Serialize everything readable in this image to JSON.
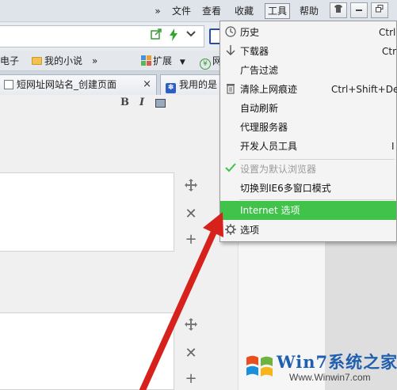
{
  "titlebar": {
    "menus": [
      {
        "label": "»"
      },
      {
        "label": "文件"
      },
      {
        "label": "查看"
      },
      {
        "label": "收藏"
      },
      {
        "label": "工具",
        "active": true
      },
      {
        "label": "帮助"
      }
    ],
    "window_buttons": [
      "shirt-icon",
      "minimize-icon",
      "restore-icon"
    ]
  },
  "bookmarks": {
    "items": [
      {
        "label": "电子",
        "icon": "folder-icon"
      },
      {
        "label": "我的小说",
        "icon": "folder-icon"
      },
      {
        "label": "»"
      },
      {
        "label": "扩展",
        "icon": "extensions-icon"
      },
      {
        "label": "网",
        "icon": "yen-icon"
      }
    ]
  },
  "tabs": [
    {
      "label": "短网址网站名_创建页面",
      "close": "×"
    },
    {
      "label": "我用的是"
    }
  ],
  "editor": {
    "format_buttons": [
      "B",
      "I"
    ]
  },
  "tools_menu": {
    "items": [
      {
        "label": "历史",
        "shortcut": "Ctrl",
        "icon": "clock-icon"
      },
      {
        "label": "下载器",
        "shortcut": "Ctr",
        "icon": "download-arrow-icon"
      },
      {
        "label": "广告过滤",
        "shortcut": ""
      },
      {
        "label": "清除上网痕迹",
        "shortcut": "Ctrl+Shift+Del",
        "icon": "trash-icon"
      },
      {
        "label": "自动刷新",
        "shortcut": ""
      },
      {
        "label": "代理服务器",
        "shortcut": ""
      },
      {
        "label": "开发人员工具",
        "shortcut": "I"
      },
      {
        "label": "设置为默认浏览器",
        "shortcut": "",
        "disabled": true,
        "icon": "checkmark-icon"
      },
      {
        "label": "切换到IE6多窗口模式",
        "shortcut": ""
      },
      {
        "label": "Internet 选项",
        "shortcut": "",
        "highlight": true
      },
      {
        "label": "选项",
        "shortcut": "",
        "icon": "gear-icon"
      }
    ]
  },
  "watermark": {
    "title": "Win7系统之家",
    "url": "Www.Winwin7.com"
  },
  "colors": {
    "highlight": "#41c24a",
    "arrow": "#d7211c",
    "watermark_blue": "#1f5fb0"
  }
}
